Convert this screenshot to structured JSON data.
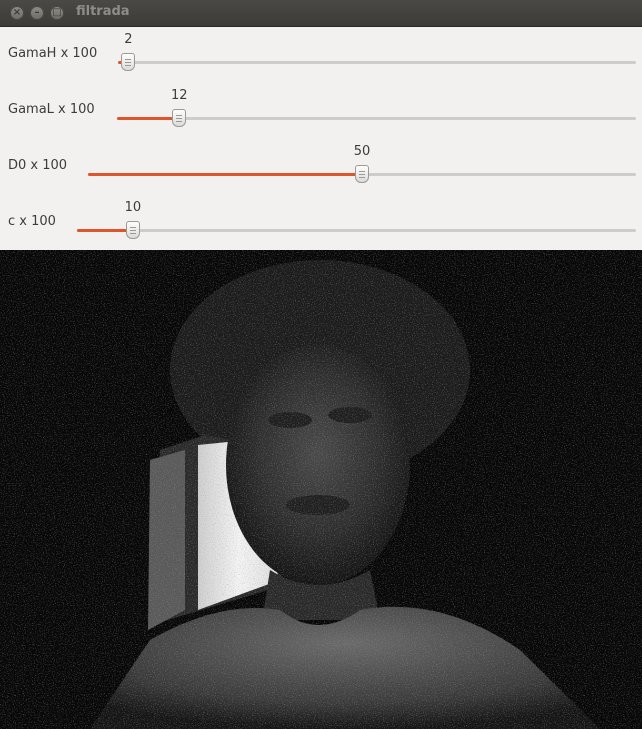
{
  "window": {
    "title": "filtrada"
  },
  "trackbars": [
    {
      "label": "GamaH x 100",
      "value": "2",
      "fraction": 0.02
    },
    {
      "label": "GamaL x 100",
      "value": "12",
      "fraction": 0.12
    },
    {
      "label": "D0 x 100",
      "value": "50",
      "fraction": 0.5
    },
    {
      "label": "c x 100",
      "value": "10",
      "fraction": 0.1
    }
  ],
  "colors": {
    "accent": "#e0542a",
    "panel": "#f2f1f0",
    "titlebar": "#3c3b37"
  },
  "icons": [
    "close-icon",
    "minimize-icon",
    "maximize-icon"
  ]
}
